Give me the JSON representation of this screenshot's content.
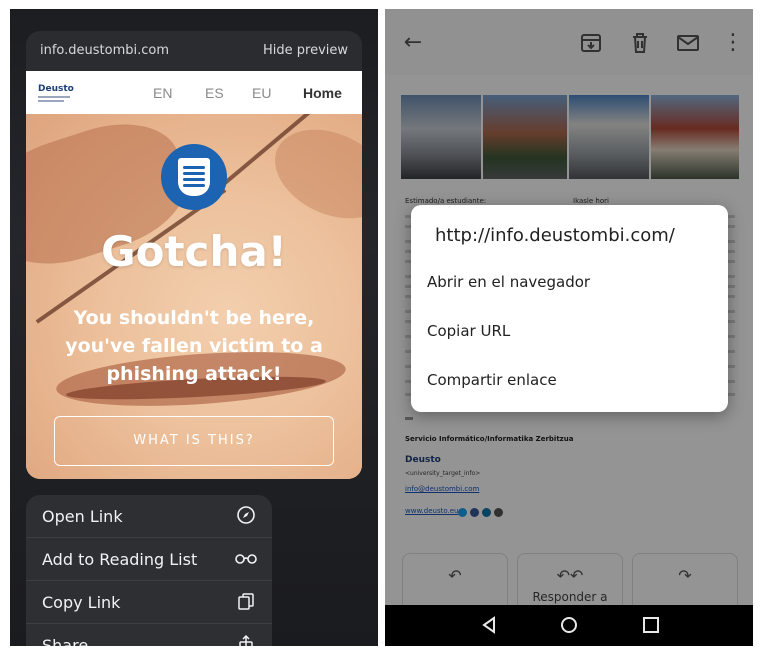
{
  "left_panel": {
    "url": "info.deustombi.com",
    "hide_preview": "Hide preview",
    "site": {
      "logo": "Deusto",
      "nav": [
        "EN",
        "ES",
        "EU"
      ],
      "home": "Home",
      "headline": "Gotcha!",
      "message": "You shouldn't be here, you've fallen victim to a phishing attack!",
      "button": "WHAT IS THIS?"
    },
    "menu": [
      {
        "label": "Open Link",
        "icon": "compass-icon"
      },
      {
        "label": "Add to Reading List",
        "icon": "glasses-icon"
      },
      {
        "label": "Copy Link",
        "icon": "copy-icon"
      },
      {
        "label": "Share",
        "icon": "share-icon"
      }
    ]
  },
  "right_panel": {
    "toolbar": {
      "back": "back-arrow-icon",
      "archive": "archive-icon",
      "delete": "trash-icon",
      "mail": "mail-icon",
      "more": "more-icon"
    },
    "email": {
      "greeting_es": "Estimado/a estudiante:",
      "greeting_eu": "Ikasle hori",
      "signature_title": "Servicio Informático/Informatika Zerbitzua",
      "signature_logo": "Deusto",
      "signature_small": "<university_target_info>",
      "email_link": "info@deustombi.com",
      "web_link": "www.deusto.eu"
    },
    "dialog": {
      "title": "http://info.deustombi.com/",
      "options": [
        "Abrir en el navegador",
        "Copiar URL",
        "Compartir enlace"
      ]
    },
    "reply_cards": [
      {
        "icon": "reply-icon",
        "label": ""
      },
      {
        "icon": "reply-all-icon",
        "label": "Responder a"
      },
      {
        "icon": "forward-icon",
        "label": ""
      }
    ],
    "navbar": [
      "back-triangle-icon",
      "home-circle-icon",
      "recents-square-icon"
    ]
  }
}
